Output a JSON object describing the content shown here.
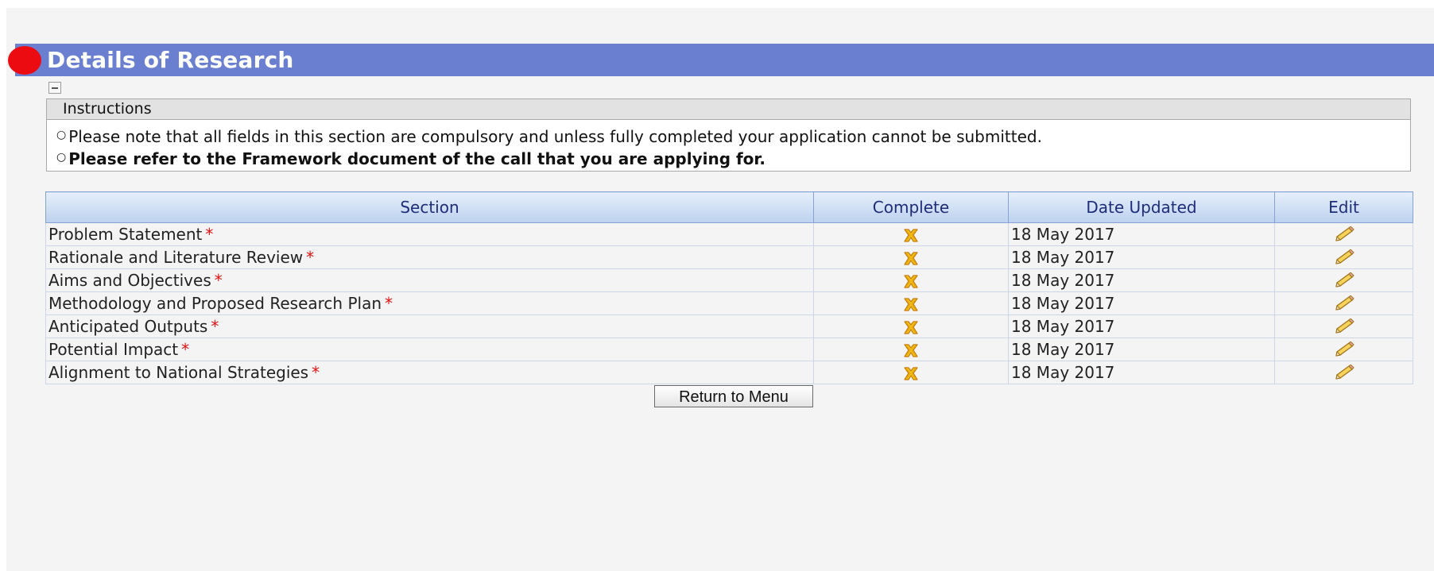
{
  "header": {
    "title": "Details of Research"
  },
  "instructions": {
    "title": "Instructions",
    "lines": [
      "Please note that all fields in this section are compulsory and unless fully completed your application cannot be submitted.",
      "Please refer to the Framework document of the call that you are applying for."
    ]
  },
  "table": {
    "columns": [
      "Section",
      "Complete",
      "Date Updated",
      "Edit"
    ],
    "rows": [
      {
        "section": "Problem Statement",
        "required": "*",
        "complete_icon": "incomplete-x-icon",
        "date": "18 May 2017",
        "edit_icon": "pencil-icon"
      },
      {
        "section": "Rationale and Literature Review",
        "required": "*",
        "complete_icon": "incomplete-x-icon",
        "date": "18 May 2017",
        "edit_icon": "pencil-icon"
      },
      {
        "section": "Aims and Objectives",
        "required": "*",
        "complete_icon": "incomplete-x-icon",
        "date": "18 May 2017",
        "edit_icon": "pencil-icon"
      },
      {
        "section": "Methodology and Proposed Research Plan",
        "required": "*",
        "complete_icon": "incomplete-x-icon",
        "date": "18 May 2017",
        "edit_icon": "pencil-icon"
      },
      {
        "section": "Anticipated Outputs",
        "required": "*",
        "complete_icon": "incomplete-x-icon",
        "date": "18 May 2017",
        "edit_icon": "pencil-icon"
      },
      {
        "section": "Potential Impact",
        "required": "*",
        "complete_icon": "incomplete-x-icon",
        "date": "18 May 2017",
        "edit_icon": "pencil-icon"
      },
      {
        "section": "Alignment to National Strategies",
        "required": "*",
        "complete_icon": "incomplete-x-icon",
        "date": "18 May 2017",
        "edit_icon": "pencil-icon"
      }
    ]
  },
  "buttons": {
    "return_label": "Return to Menu"
  },
  "colors": {
    "header_bar": "#6b7fd1",
    "indicator": "#ec0b10",
    "required_mark": "#e51010",
    "column_header_text": "#1d2d7a"
  }
}
